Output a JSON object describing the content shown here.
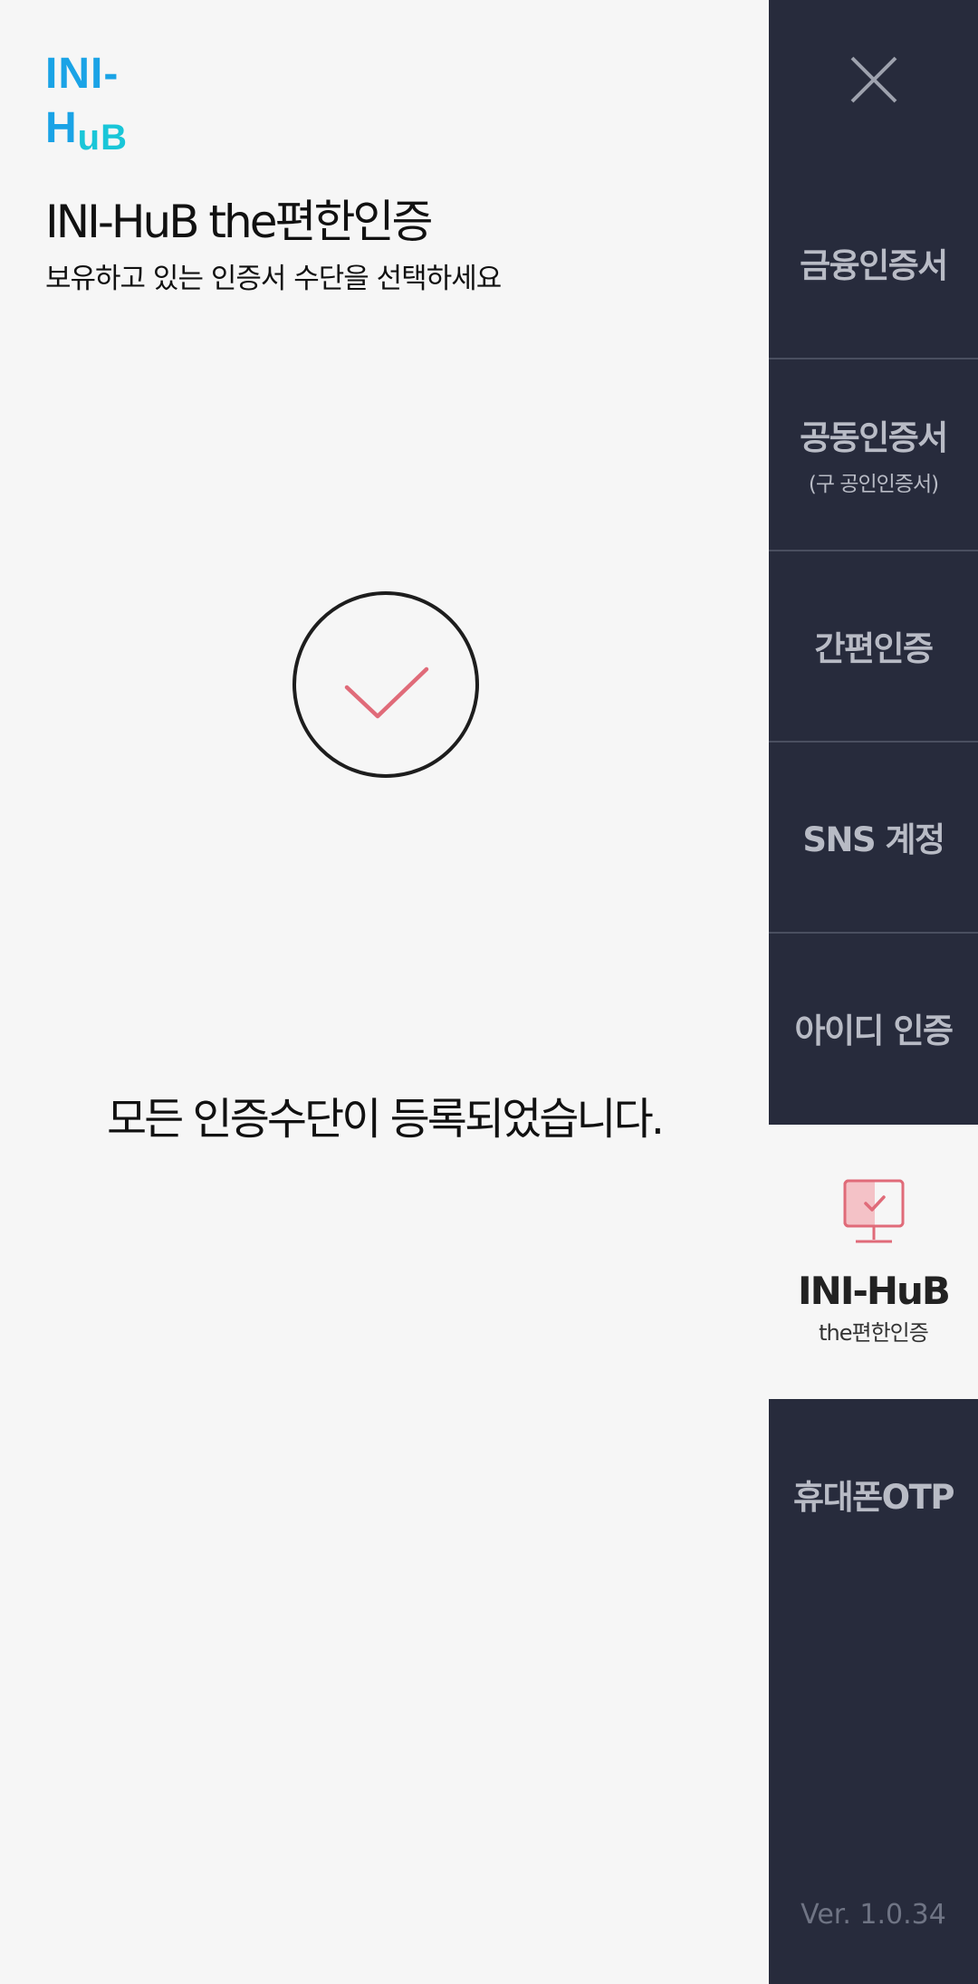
{
  "logo": {
    "text_main": "INI-H",
    "text_tail": "uB"
  },
  "header": {
    "title": "INI-HuB the편한인증",
    "subtitle": "보유하고 있는 인증서 수단을 선택하세요"
  },
  "main": {
    "status_message": "모든 인증수단이 등록되었습니다."
  },
  "sidebar": {
    "close_icon": "close-icon",
    "items": [
      {
        "label": "금융인증서",
        "sub": ""
      },
      {
        "label": "공동인증서",
        "sub": "(구 공인인증서)"
      },
      {
        "label": "간편인증",
        "sub": ""
      },
      {
        "label": "SNS 계정",
        "sub": ""
      },
      {
        "label": "아이디 인증",
        "sub": ""
      },
      {
        "label": "INI-HuB",
        "sub": "the편한인증",
        "icon": "monitor-check-icon",
        "active": true
      },
      {
        "label": "휴대폰OTP",
        "sub": ""
      }
    ],
    "version": "Ver. 1.0.34"
  },
  "colors": {
    "sidebar_bg": "#272b3c",
    "accent_check": "#e06b79",
    "logo_blue": "#1aa3e6",
    "logo_cyan": "#19c6d8"
  }
}
